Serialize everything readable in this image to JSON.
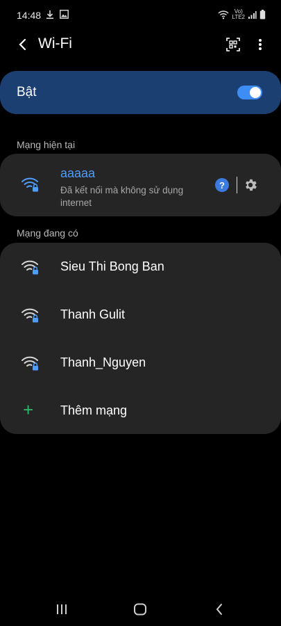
{
  "status_bar": {
    "time": "14:48",
    "network_top": "Vo)",
    "network_bottom": "LTE2"
  },
  "app_bar": {
    "title": "Wi-Fi",
    "back_icon": "back-arrow-icon",
    "qr_icon": "qr-scan-icon",
    "more_icon": "more-vert-icon"
  },
  "wifi_toggle": {
    "label": "Bật",
    "enabled": true,
    "accent": "#3e8df5",
    "card_color": "#1c3f72"
  },
  "current_section": {
    "header": "Mạng hiện tại",
    "network": {
      "name": "aaaaa",
      "status": "Đã kết nối mà không sử dụng internet",
      "name_color": "#4f9dff",
      "help_glyph": "?",
      "settings_icon": "gear-icon"
    }
  },
  "available_section": {
    "header": "Mạng đang có",
    "networks": [
      {
        "name": "Sieu Thi Bong Ban",
        "icon": "wifi-locked-icon"
      },
      {
        "name": "Thanh Gulit",
        "icon": "wifi-locked-icon"
      },
      {
        "name": "Thanh_Nguyen",
        "icon": "wifi-locked-icon"
      }
    ],
    "add_network": {
      "label": "Thêm mạng",
      "icon": "plus-icon",
      "color": "#34b36b"
    }
  },
  "nav_bar": {
    "recents_icon": "recents-icon",
    "home_icon": "home-icon",
    "back_icon": "nav-back-icon"
  }
}
